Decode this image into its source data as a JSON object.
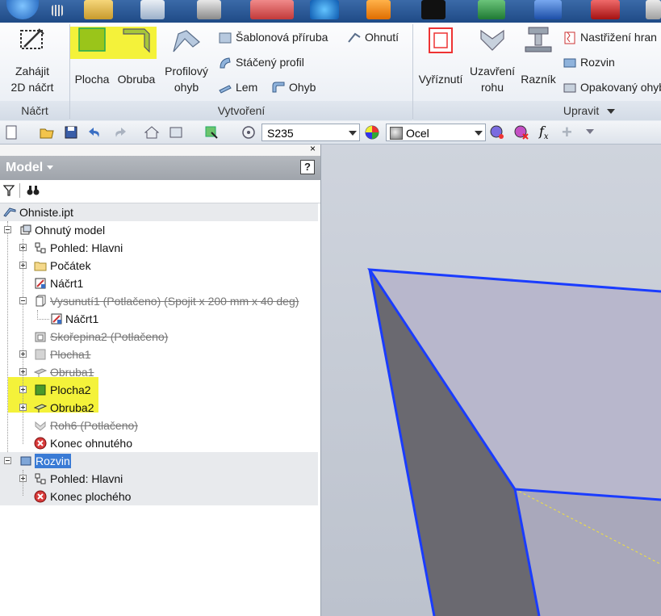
{
  "ribbon": {
    "sketch_panel": {
      "title": "Náčrt",
      "start_label_1": "Zahájit",
      "start_label_2": "2D náčrt"
    },
    "create_panel": {
      "title": "Vytvoření",
      "plocha": "Plocha",
      "obruba": "Obruba",
      "profilovy_1": "Profilový",
      "profilovy_2": "ohyb",
      "sablonova": "Šablonová příruba",
      "ohnuti": "Ohnutí",
      "staceny": "Stáčený profil",
      "lem": "Lem",
      "ohyb": "Ohyb"
    },
    "modify_panel": {
      "title": "Upravit",
      "vyriznuti": "Vyříznutí",
      "uzavreni_1": "Uzavření",
      "uzavreni_2": "rohu",
      "raznik": "Razník",
      "nastrizeni": "Nastřižení hran",
      "rozvin": "Rozvin",
      "opakovany": "Opakovaný ohyb"
    }
  },
  "toolbar": {
    "material_style": "S235",
    "appearance": "Ocel"
  },
  "browser": {
    "title": "Model",
    "close": "×",
    "help": "?",
    "tree": [
      {
        "label": "Ohniste.ipt"
      },
      {
        "label": "Ohnutý model"
      },
      {
        "label": "Pohled: Hlavni"
      },
      {
        "label": "Počátek"
      },
      {
        "label": "Náčrt1"
      },
      {
        "label": "Vysunutí1 (Potlačeno) (Spojit x 200 mm x 40 deg)"
      },
      {
        "label": "Náčrt1"
      },
      {
        "label": "Skořepina2 (Potlačeno)"
      },
      {
        "label": "Plocha1"
      },
      {
        "label": "Obruba1"
      },
      {
        "label": "Plocha2"
      },
      {
        "label": "Obruba2"
      },
      {
        "label": "Roh6 (Potlačeno)"
      },
      {
        "label": "Konec ohnutého"
      },
      {
        "label": "Rozvin"
      },
      {
        "label": "Pohled: Hlavni"
      },
      {
        "label": "Konec plochého"
      }
    ]
  },
  "colors": {
    "highlight": "#f4f23a",
    "edge": "#1a3cff",
    "selection": "#3a7bd5"
  }
}
